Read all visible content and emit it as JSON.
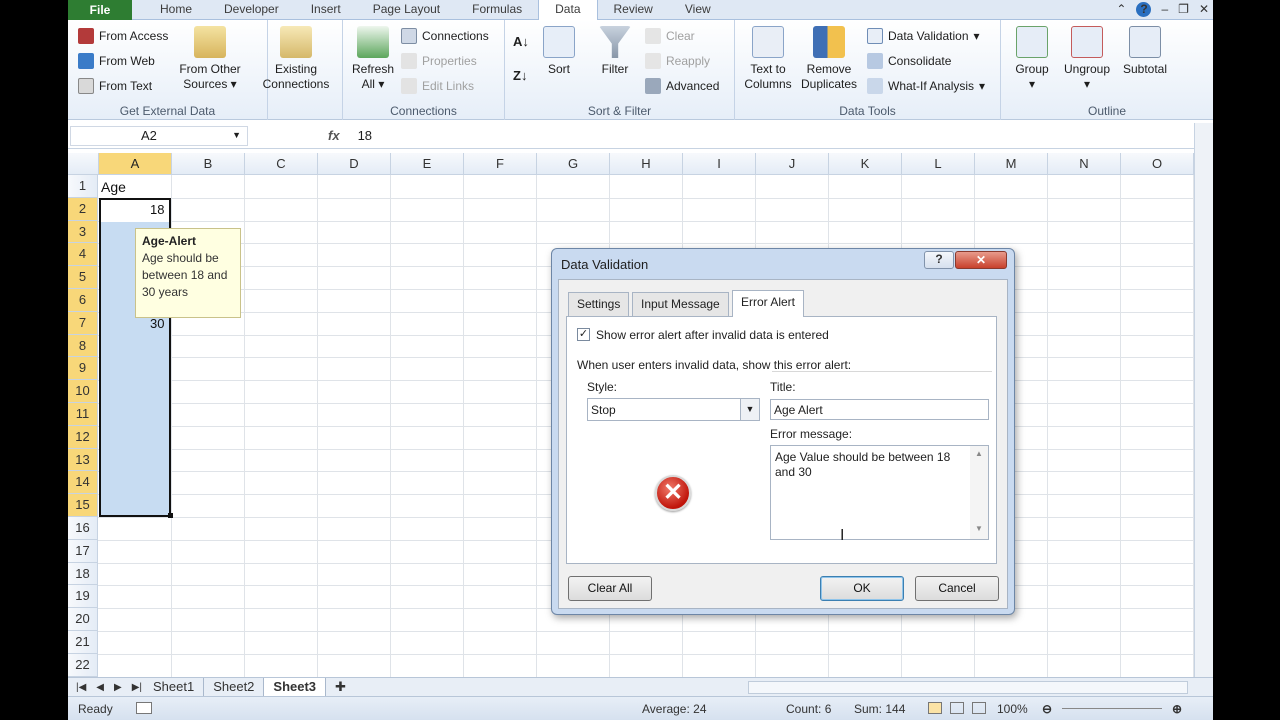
{
  "tabs": [
    "File",
    "Home",
    "Developer",
    "Insert",
    "Page Layout",
    "Formulas",
    "Data",
    "Review",
    "View"
  ],
  "active_tab": "Data",
  "ribbon": {
    "get_external": {
      "from_access": "From Access",
      "from_web": "From Web",
      "from_text": "From Text",
      "from_other": "From Other",
      "sources": "Sources",
      "existing": "Existing",
      "connections_btn": "Connections",
      "label": "Get External Data"
    },
    "connections": {
      "refresh": "Refresh",
      "all": "All",
      "connections": "Connections",
      "properties": "Properties",
      "edit_links": "Edit Links",
      "label": "Connections"
    },
    "sort_filter": {
      "sort": "Sort",
      "filter": "Filter",
      "clear": "Clear",
      "reapply": "Reapply",
      "advanced": "Advanced",
      "label": "Sort & Filter"
    },
    "data_tools": {
      "text_to": "Text to",
      "columns": "Columns",
      "remove": "Remove",
      "duplicates": "Duplicates",
      "data_validation": "Data Validation",
      "consolidate": "Consolidate",
      "whatif": "What-If Analysis",
      "label": "Data Tools"
    },
    "outline": {
      "group": "Group",
      "ungroup": "Ungroup",
      "subtotal": "Subtotal",
      "label": "Outline"
    }
  },
  "formula_bar": {
    "name_box": "A2",
    "fx": "fx",
    "value": "18"
  },
  "columns": [
    "A",
    "B",
    "C",
    "D",
    "E",
    "F",
    "G",
    "H",
    "I",
    "J",
    "K",
    "L",
    "M",
    "N",
    "O"
  ],
  "rows": [
    "1",
    "2",
    "3",
    "4",
    "5",
    "6",
    "7",
    "8",
    "9",
    "10",
    "11",
    "12",
    "13",
    "14",
    "15",
    "16",
    "17",
    "18",
    "19",
    "20",
    "21",
    "22"
  ],
  "cells": {
    "a1": "Age",
    "a2": "18",
    "a7": "30"
  },
  "tooltip": {
    "title": "Age-Alert",
    "line1": "Age should be",
    "line2": "between 18 and",
    "line3": "30 years"
  },
  "sheets": [
    "Sheet1",
    "Sheet2",
    "Sheet3"
  ],
  "status": {
    "ready": "Ready",
    "average": "Average: 24",
    "count": "Count: 6",
    "sum": "Sum: 144",
    "zoom": "100%"
  },
  "dialog": {
    "title": "Data Validation",
    "help": "?",
    "tabs": [
      "Settings",
      "Input Message",
      "Error Alert"
    ],
    "show_alert": "Show error alert after invalid data is entered",
    "when_text": "When user enters invalid data, show this error alert:",
    "style_label": "Style:",
    "style_value": "Stop",
    "title_label": "Title:",
    "title_value": "Age Alert",
    "msg_label": "Error message:",
    "msg_value": "Age Value should be between 18 and 30",
    "clear_all": "Clear All",
    "ok": "OK",
    "cancel": "Cancel"
  }
}
